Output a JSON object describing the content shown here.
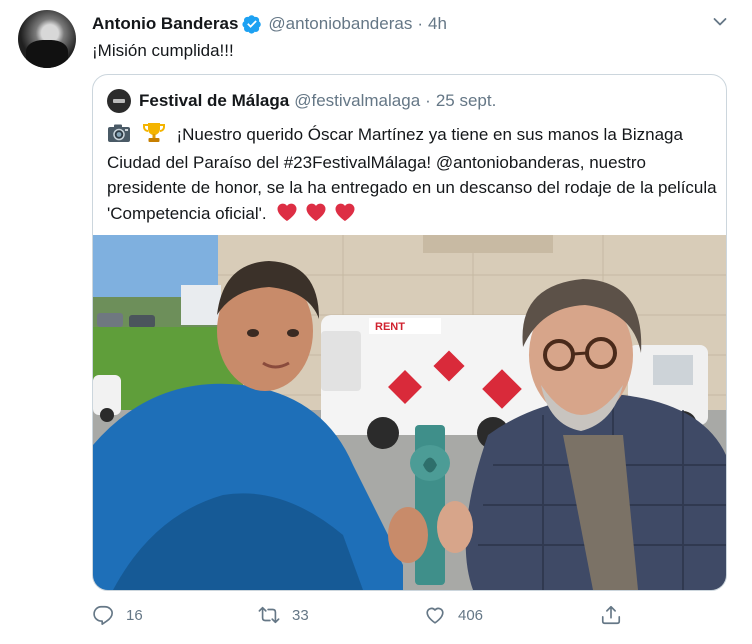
{
  "tweet": {
    "author_name": "Antonio Banderas",
    "author_handle": "@antoniobanderas",
    "separator": "·",
    "time": "4h",
    "text": "¡Misión cumplida!!!"
  },
  "quote": {
    "author_name": "Festival de Málaga",
    "author_handle": "@festivalmalaga",
    "separator": "·",
    "date": "25 sept.",
    "emoji_prefix": [
      "camera-emoji",
      "trophy-emoji"
    ],
    "text": "¡Nuestro querido Óscar Martínez ya tiene en sus manos la Biznaga Ciudad del Paraíso del #23FestivalMálaga! @antoniobanderas, nuestro presidente de honor, se la ha entregado en un descanso del rodaje de la película 'Competencia oficial'.",
    "emoji_suffix": [
      "red-heart-emoji",
      "red-heart-emoji",
      "red-heart-emoji"
    ],
    "media_truck_logo": "RENT"
  },
  "actions": {
    "reply_count": "16",
    "retweet_count": "33",
    "like_count": "406"
  },
  "colors": {
    "text": "#14171a",
    "secondary": "#657786",
    "border": "#ccd6dd",
    "verified": "#1da1f2",
    "heart": "#e0245e"
  },
  "icons": [
    "verified-icon",
    "chevron-down-icon",
    "reply-icon",
    "retweet-icon",
    "like-icon",
    "share-icon"
  ]
}
